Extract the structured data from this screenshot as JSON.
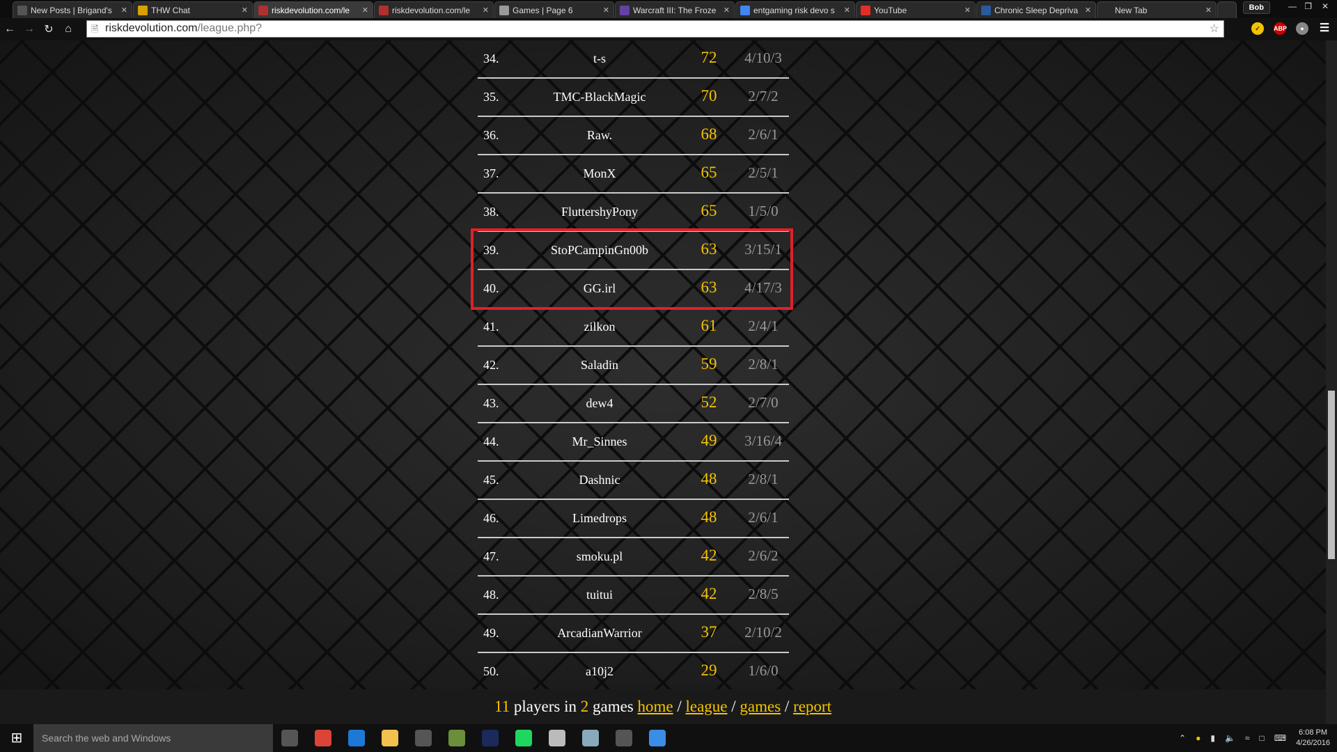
{
  "browser": {
    "tabs": [
      {
        "title": "New Posts | Brigand's",
        "icon": "forum-icon",
        "color": "#555"
      },
      {
        "title": "THW Chat",
        "icon": "hive-icon",
        "color": "#d8a000"
      },
      {
        "title": "riskdevolution.com/le",
        "icon": "risk-icon",
        "color": "#b03030",
        "active": true
      },
      {
        "title": "riskdevolution.com/le",
        "icon": "risk-icon",
        "color": "#b03030"
      },
      {
        "title": "Games | Page 6",
        "icon": "e-icon",
        "color": "#999"
      },
      {
        "title": "Warcraft III: The Froze",
        "icon": "twitch-icon",
        "color": "#6441a4"
      },
      {
        "title": "entgaming risk devo s",
        "icon": "google-icon",
        "color": "#4285f4"
      },
      {
        "title": "YouTube",
        "icon": "youtube-icon",
        "color": "#e52d27"
      },
      {
        "title": "Chronic Sleep Depriva",
        "icon": "webmd-icon",
        "color": "#2a5a9a"
      },
      {
        "title": "New Tab",
        "icon": "none",
        "color": "transparent"
      }
    ],
    "user": "Bob",
    "url_host": "riskdevolution.com",
    "url_path": "/league.php?"
  },
  "league": {
    "rows": [
      {
        "rank": "34.",
        "name": "t-s",
        "score": "72",
        "record": "4/10/3"
      },
      {
        "rank": "35.",
        "name": "TMC-BlackMagic",
        "score": "70",
        "record": "2/7/2"
      },
      {
        "rank": "36.",
        "name": "Raw.",
        "score": "68",
        "record": "2/6/1"
      },
      {
        "rank": "37.",
        "name": "MonX",
        "score": "65",
        "record": "2/5/1"
      },
      {
        "rank": "38.",
        "name": "FluttershyPony",
        "score": "65",
        "record": "1/5/0"
      },
      {
        "rank": "39.",
        "name": "StoPCampinGn00b",
        "score": "63",
        "record": "3/15/1"
      },
      {
        "rank": "40.",
        "name": "GG.irl",
        "score": "63",
        "record": "4/17/3"
      },
      {
        "rank": "41.",
        "name": "zilkon",
        "score": "61",
        "record": "2/4/1"
      },
      {
        "rank": "42.",
        "name": "Saladin",
        "score": "59",
        "record": "2/8/1"
      },
      {
        "rank": "43.",
        "name": "dew4",
        "score": "52",
        "record": "2/7/0"
      },
      {
        "rank": "44.",
        "name": "Mr_Sinnes",
        "score": "49",
        "record": "3/16/4"
      },
      {
        "rank": "45.",
        "name": "Dashnic",
        "score": "48",
        "record": "2/8/1"
      },
      {
        "rank": "46.",
        "name": "Limedrops",
        "score": "48",
        "record": "2/6/1"
      },
      {
        "rank": "47.",
        "name": "smoku.pl",
        "score": "42",
        "record": "2/6/2"
      },
      {
        "rank": "48.",
        "name": "tuitui",
        "score": "42",
        "record": "2/8/5"
      },
      {
        "rank": "49.",
        "name": "ArcadianWarrior",
        "score": "37",
        "record": "2/10/2"
      },
      {
        "rank": "50.",
        "name": "a10j2",
        "score": "29",
        "record": "1/6/0"
      }
    ],
    "highlight_color": "#e0202a"
  },
  "footer": {
    "players": "11",
    "players_text": " players in ",
    "games": "2",
    "games_text": " games ",
    "links": [
      "home",
      "league",
      "games",
      "report"
    ],
    "sep": " / "
  },
  "taskbar": {
    "search_placeholder": "Search the web and Windows",
    "time": "6:08 PM",
    "date": "4/26/2016",
    "apps": [
      {
        "icon": "task-view-icon",
        "color": "#555"
      },
      {
        "icon": "chrome-icon",
        "color": "#db4437"
      },
      {
        "icon": "edge-icon",
        "color": "#1e78d7"
      },
      {
        "icon": "file-explorer-icon",
        "color": "#f2c14e"
      },
      {
        "icon": "warcraft-icon",
        "color": "#555"
      },
      {
        "icon": "minecraft-icon",
        "color": "#6b8e3a"
      },
      {
        "icon": "photoshop-icon",
        "color": "#1b2a5a"
      },
      {
        "icon": "spotify-icon",
        "color": "#1ed760"
      },
      {
        "icon": "app-icon",
        "color": "#bbb"
      },
      {
        "icon": "app-icon",
        "color": "#8ab"
      },
      {
        "icon": "warcraft-icon",
        "color": "#555"
      },
      {
        "icon": "clock-app-icon",
        "color": "#3a8ee6"
      }
    ]
  }
}
